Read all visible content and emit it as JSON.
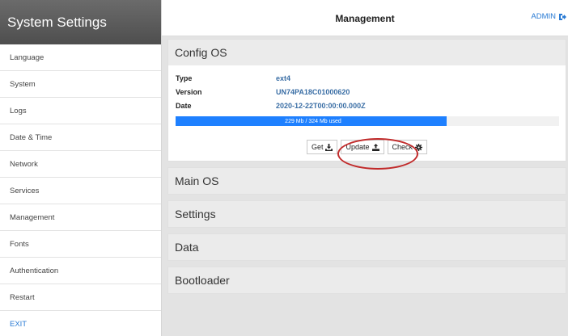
{
  "sidebar": {
    "title": "System Settings",
    "items": [
      {
        "label": "Language"
      },
      {
        "label": "System"
      },
      {
        "label": "Logs"
      },
      {
        "label": "Date & Time"
      },
      {
        "label": "Network"
      },
      {
        "label": "Services"
      },
      {
        "label": "Management"
      },
      {
        "label": "Fonts"
      },
      {
        "label": "Authentication"
      },
      {
        "label": "Restart"
      },
      {
        "label": "EXIT"
      }
    ]
  },
  "header": {
    "title": "Management",
    "user_label": "ADMIN",
    "user_icon": "logout-icon"
  },
  "panels": {
    "config_os": {
      "title": "Config OS",
      "rows": [
        {
          "label": "Type",
          "value": "ext4"
        },
        {
          "label": "Version",
          "value": "UN74PA18C01000620"
        },
        {
          "label": "Date",
          "value": "2020-12-22T00:00:00.000Z"
        }
      ],
      "usage": {
        "text": "229 Mb / 324 Mb used",
        "fraction": 0.7068
      },
      "buttons": {
        "get": "Get",
        "update": "Update",
        "check": "Check"
      }
    },
    "main_os": {
      "title": "Main OS"
    },
    "settings": {
      "title": "Settings"
    },
    "data": {
      "title": "Data"
    },
    "bootloader": {
      "title": "Bootloader"
    }
  },
  "colors": {
    "accent": "#2a7bd4",
    "progress": "#1e80ff",
    "highlight": "#c12a2a"
  }
}
